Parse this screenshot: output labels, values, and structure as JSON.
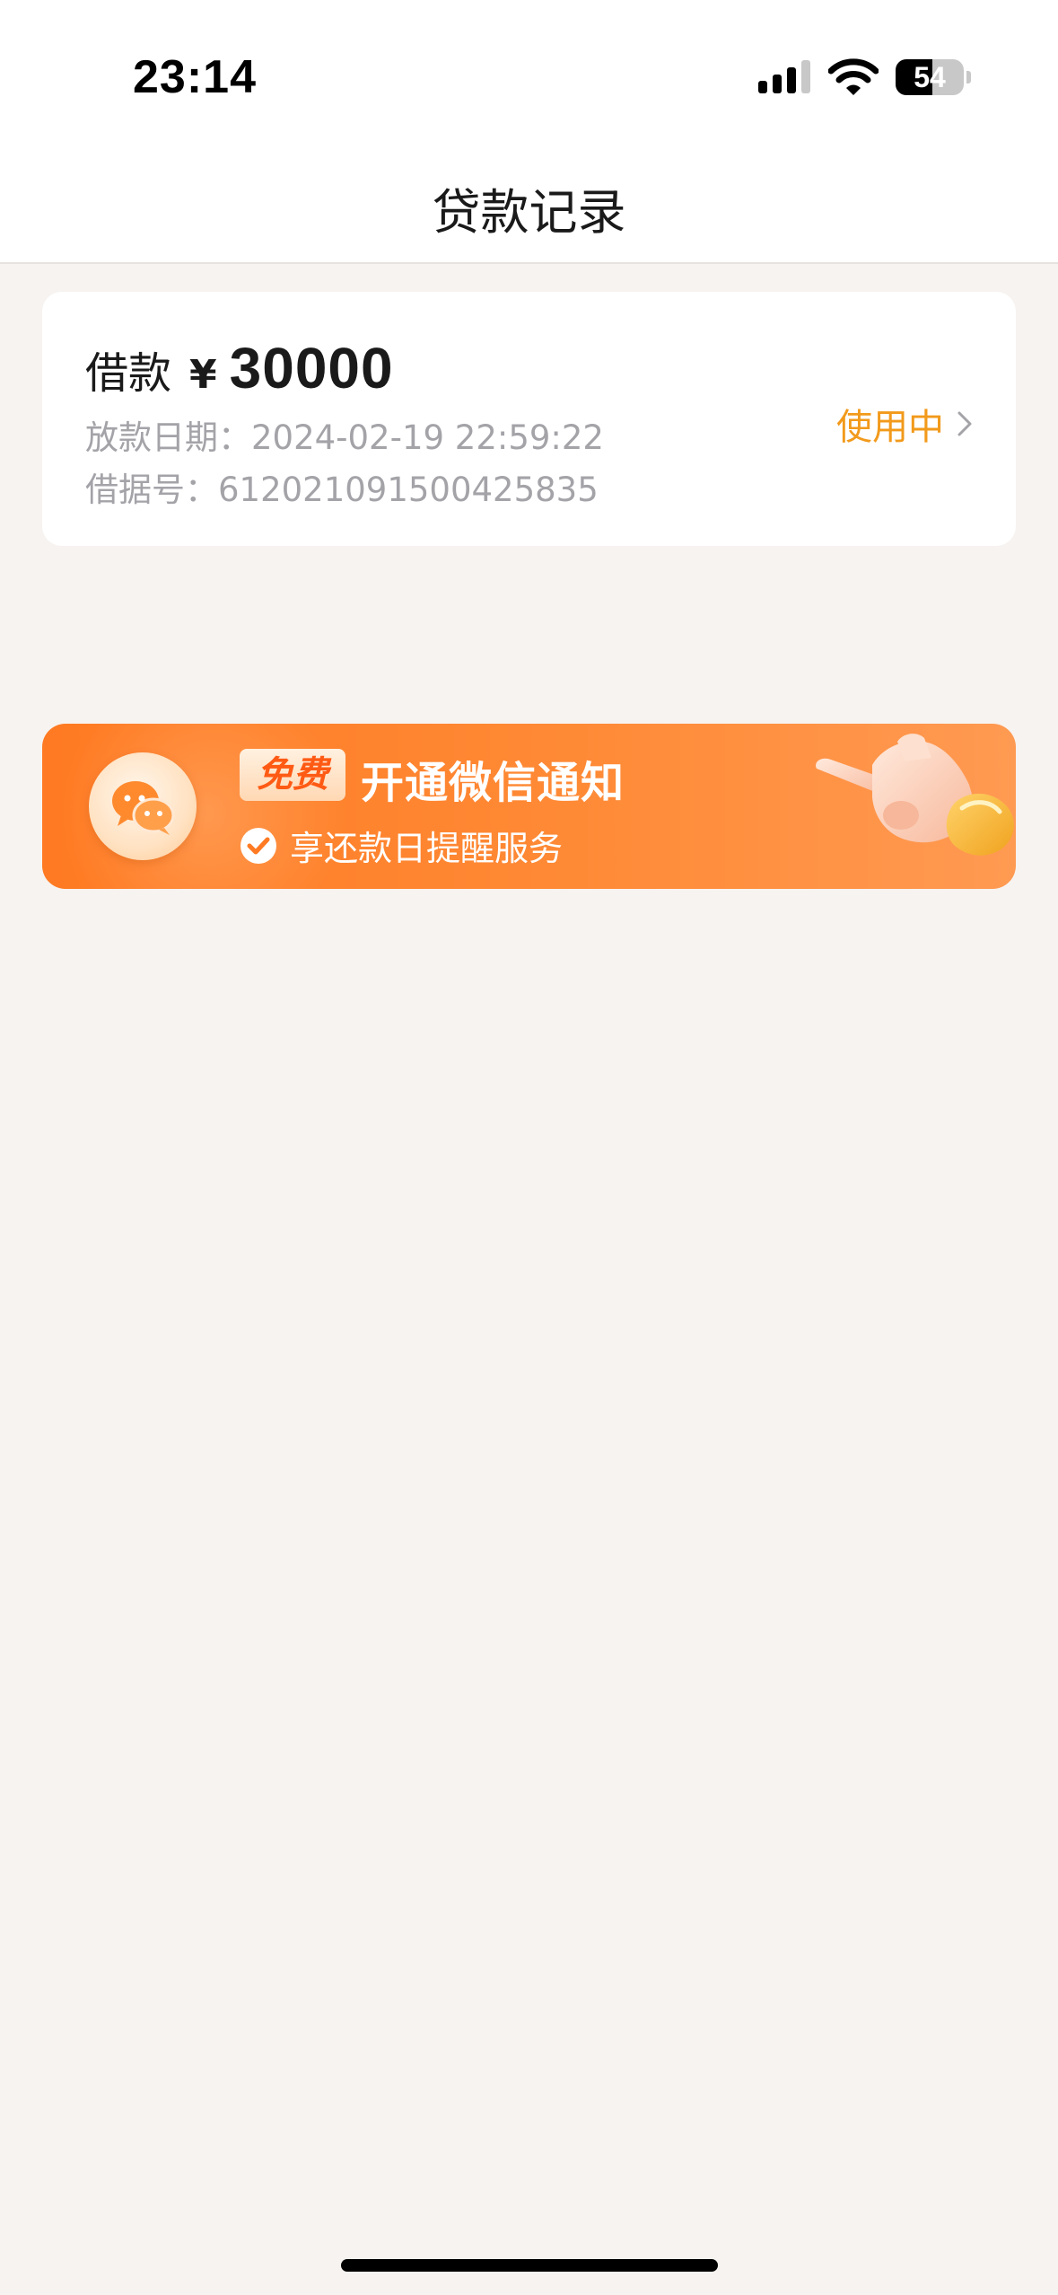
{
  "status_bar": {
    "time": "23:14",
    "battery_level": "54",
    "battery_fraction": 0.54,
    "icons": [
      "signal-icon",
      "wifi-icon",
      "battery-icon"
    ]
  },
  "nav": {
    "title": "贷款记录"
  },
  "loan": {
    "label": "借款",
    "currency": "¥",
    "amount": "30000",
    "date_line": "放款日期：2024-02-19 22:59:22",
    "receipt_line": "借据号：612021091500425835",
    "status": "使用中",
    "status_color": "#f29a1b"
  },
  "banner": {
    "badge": "免费",
    "title": "开通微信通知",
    "subtitle": "享还款日提醒服务",
    "colors": {
      "start": "#ff7a22",
      "end": "#ff9a52"
    },
    "icons": [
      "wechat-icon",
      "check-circle-icon",
      "pointing-hand-icon"
    ]
  },
  "colors": {
    "page_background": "#f7f3f0",
    "muted_text": "#a3a3a8"
  }
}
